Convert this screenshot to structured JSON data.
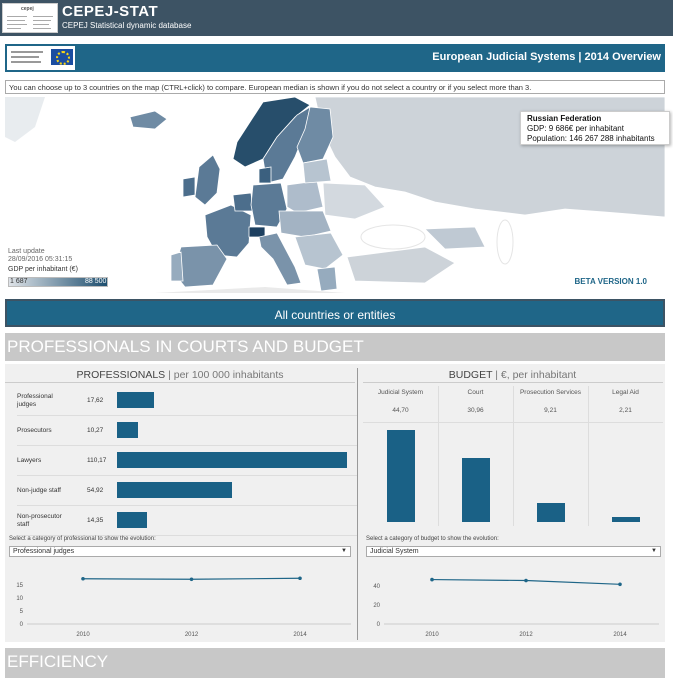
{
  "topbar": {
    "logo_text": "cepej",
    "title": "CEPEJ-STAT",
    "subtitle": "CEPEJ Statistical dynamic database"
  },
  "dashboard": {
    "title": "European Judicial Systems | 2014 Overview"
  },
  "info": "You can choose up to 3 countries on the map (CTRL+click) to compare. European median is shown if you do not select a country or if you select more than 3.",
  "map": {
    "last_update_label": "Last update",
    "last_update": "28/09/2016 05:31:15",
    "legend_label": "GDP per inhabitant (€)",
    "legend_min": "1 687",
    "legend_max": "88 500",
    "legend_colors": [
      "#dfe3e8",
      "#1d4e6e"
    ],
    "tooltip": {
      "country": "Russian Federation",
      "gdp": "GDP: 9 686€ per inhabitant",
      "population": "Population: 146 267 288 inhabitants"
    },
    "beta": "BETA VERSION 1.0"
  },
  "all_button": "All countries or entities",
  "section1": "PROFESSIONALS IN COURTS AND BUDGET",
  "professionals": {
    "title": "PROFESSIONALS",
    "title_unit": "| per 100 000 inhabitants",
    "rows": [
      {
        "label": "Professional judges",
        "value": "17,62",
        "num": 17.62
      },
      {
        "label": "Prosecutors",
        "value": "10,27",
        "num": 10.27
      },
      {
        "label": "Lawyers",
        "value": "110,17",
        "num": 110.17
      },
      {
        "label": "Non-judge staff",
        "value": "54,92",
        "num": 54.92
      },
      {
        "label": "Non-prosecutor staff",
        "value": "14,35",
        "num": 14.35
      }
    ],
    "select_hint": "Select a category of professional to show the evolution:",
    "selected": "Professional judges",
    "chart": {
      "years": [
        "2010",
        "2012",
        "2014"
      ],
      "values": [
        17.4,
        17.2,
        17.6
      ],
      "yticks": [
        "0",
        "5",
        "10",
        "15"
      ],
      "ymax": 20
    }
  },
  "budget": {
    "title": "BUDGET",
    "title_unit": "| €, per inhabitant",
    "columns": [
      {
        "label": "Judicial System",
        "value": "44,70",
        "num": 44.7
      },
      {
        "label": "Court",
        "value": "30,96",
        "num": 30.96
      },
      {
        "label": "Prosecution Services",
        "value": "9,21",
        "num": 9.21
      },
      {
        "label": "Legal Aid",
        "value": "2,21",
        "num": 2.21
      }
    ],
    "select_hint": "Select a category of budget to show the evolution:",
    "selected": "Judicial System",
    "chart": {
      "years": [
        "2010",
        "2012",
        "2014"
      ],
      "values": [
        47,
        46,
        42
      ],
      "yticks": [
        "0",
        "20",
        "40"
      ],
      "ymax": 55
    }
  },
  "section2": "EFFICIENCY",
  "colors": {
    "accent": "#1f6688",
    "bar": "#1a6186",
    "header": "#3d5364"
  }
}
